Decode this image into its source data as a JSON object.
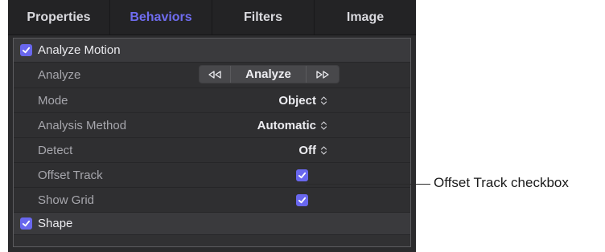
{
  "tabs": [
    {
      "label": "Properties",
      "active": false
    },
    {
      "label": "Behaviors",
      "active": true
    },
    {
      "label": "Filters",
      "active": false
    },
    {
      "label": "Image",
      "active": false
    }
  ],
  "accent_color": "#6967ee",
  "analyze_motion": {
    "label": "Analyze Motion",
    "checked": true,
    "analyze": {
      "label": "Analyze",
      "button_label": "Analyze",
      "back_icon": "rewind-icon",
      "fwd_icon": "fast-forward-icon"
    },
    "mode": {
      "label": "Mode",
      "value": "Object"
    },
    "analysis_method": {
      "label": "Analysis Method",
      "value": "Automatic"
    },
    "detect": {
      "label": "Detect",
      "value": "Off"
    },
    "offset_track": {
      "label": "Offset Track",
      "checked": true
    },
    "show_grid": {
      "label": "Show Grid",
      "checked": true
    }
  },
  "shape": {
    "label": "Shape",
    "checked": true
  },
  "callout": {
    "text": "Offset Track checkbox"
  }
}
